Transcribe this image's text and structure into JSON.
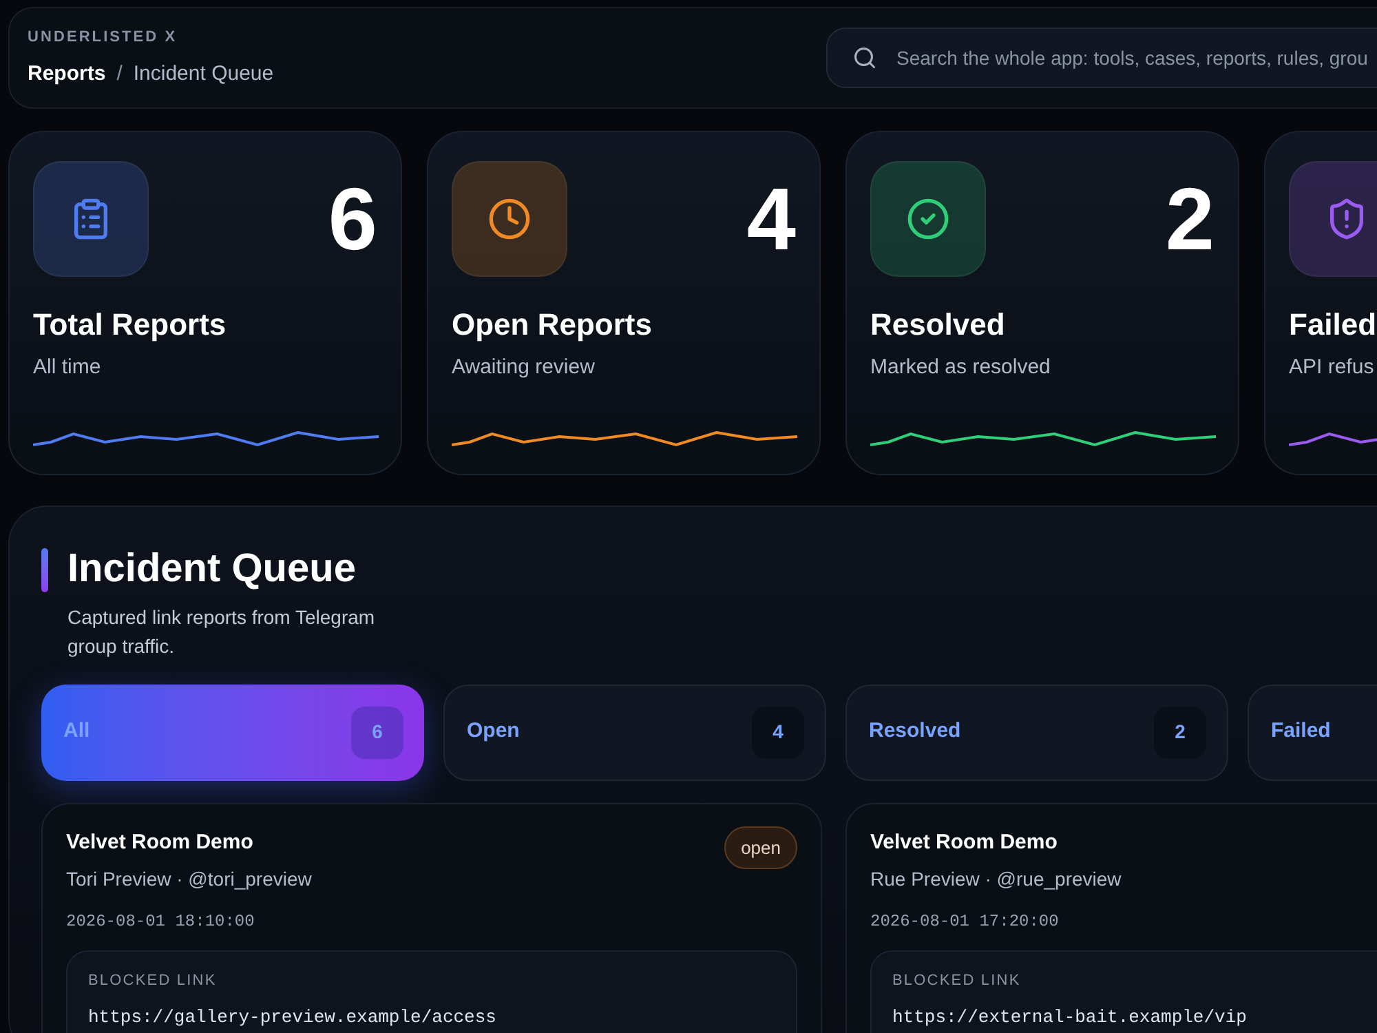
{
  "header": {
    "brand": "UNDERLISTED X",
    "breadcrumb_separator": "/",
    "breadcrumb": [
      {
        "label": "Reports",
        "current": false
      },
      {
        "label": "Incident Queue",
        "current": true
      }
    ],
    "search": {
      "placeholder": "Search the whole app: tools, cases, reports, rules, grou"
    }
  },
  "stats": [
    {
      "kind": "clipboard",
      "value": "6",
      "title": "Total Reports",
      "subtitle": "All time",
      "color": "#4f7cf0"
    },
    {
      "kind": "clock",
      "value": "4",
      "title": "Open Reports",
      "subtitle": "Awaiting review",
      "color": "#f08a24"
    },
    {
      "kind": "check",
      "value": "2",
      "title": "Resolved",
      "subtitle": "Marked as resolved",
      "color": "#2fcf7a"
    },
    {
      "kind": "shield",
      "title": "Failed",
      "subtitle": "API refus",
      "color": "#9a5cf0"
    }
  ],
  "queue": {
    "title": "Incident Queue",
    "description": "Captured link reports from Telegram group traffic.",
    "tabs": [
      {
        "label": "All",
        "count": "6",
        "selected": true
      },
      {
        "label": "Open",
        "count": "4",
        "selected": false
      },
      {
        "label": "Resolved",
        "count": "2",
        "selected": false
      },
      {
        "label": "Failed",
        "selected": false
      }
    ],
    "reports": [
      {
        "title": "Velvet Room Demo",
        "reporter": "Tori Preview · @tori_preview",
        "time": "2026-08-01 18:10:00",
        "status": "open",
        "link_label": "BLOCKED LINK",
        "link": "https://gallery-preview.example/access"
      },
      {
        "title": "Velvet Room Demo",
        "reporter": "Rue Preview · @rue_preview",
        "time": "2026-08-01 17:20:00",
        "link_label": "BLOCKED LINK",
        "link": "https://external-bait.example/vip"
      }
    ]
  }
}
